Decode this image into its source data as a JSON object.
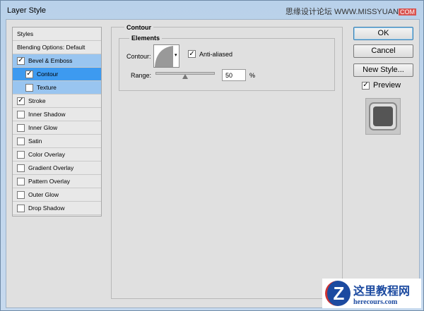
{
  "window": {
    "title": "Layer Style",
    "watermark": "思缘设计论坛 WWW.MISSYUAN",
    "watermark_badge": "COM"
  },
  "styles_list": {
    "header": "Styles",
    "blending": "Blending Options: Default",
    "items": [
      {
        "label": "Bevel & Emboss",
        "checked": true
      },
      {
        "label": "Contour",
        "checked": true
      },
      {
        "label": "Texture",
        "checked": false
      },
      {
        "label": "Stroke",
        "checked": true
      },
      {
        "label": "Inner Shadow",
        "checked": false
      },
      {
        "label": "Inner Glow",
        "checked": false
      },
      {
        "label": "Satin",
        "checked": false
      },
      {
        "label": "Color Overlay",
        "checked": false
      },
      {
        "label": "Gradient Overlay",
        "checked": false
      },
      {
        "label": "Pattern Overlay",
        "checked": false
      },
      {
        "label": "Outer Glow",
        "checked": false
      },
      {
        "label": "Drop Shadow",
        "checked": false
      }
    ]
  },
  "contour": {
    "section": "Contour",
    "group": "Elements",
    "contour_label": "Contour:",
    "anti_aliased": "Anti-aliased",
    "range_label": "Range:",
    "range_value": "50",
    "range_unit": "%",
    "range_percent": 50
  },
  "buttons": {
    "ok": "OK",
    "cancel": "Cancel",
    "new_style": "New Style...",
    "preview": "Preview"
  },
  "logo": {
    "cn": "这里教程网",
    "url": "herecours.com"
  }
}
